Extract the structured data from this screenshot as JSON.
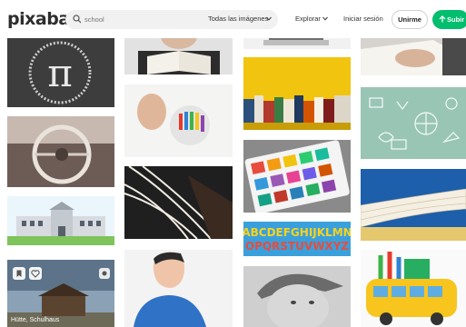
{
  "header": {
    "logo": "pixabay",
    "search_placeholder": "school",
    "filter_label": "Todas las imágenes",
    "explore_label": "Explorar",
    "login_label": "Iniciar sesión",
    "join_label": "Unirme",
    "upload_label": "Subir"
  },
  "tiles": [
    {
      "id": "chalkboard-pi",
      "description": "Chalkboard with pi symbol and digits"
    },
    {
      "id": "car-steering-wheel",
      "description": "Vintage car interior steering wheel"
    },
    {
      "id": "school-building-illustration",
      "description": "Flat illustration of school building"
    },
    {
      "id": "old-schoolhouse",
      "description": "Old wooden schoolhouse under cloudy sky"
    },
    {
      "id": "reading-book",
      "description": "Person reading a book"
    },
    {
      "id": "crayons-drawing",
      "description": "Hand drawing with crayons"
    },
    {
      "id": "open-books-pages",
      "description": "Open book pages close up"
    },
    {
      "id": "boy-silhouette",
      "description": "Illustration of boy with blue shirt"
    },
    {
      "id": "book-stack-top",
      "description": "Books stacked"
    },
    {
      "id": "books-yellow-wall",
      "description": "Books on shelf against yellow wall"
    },
    {
      "id": "watercolor-palette",
      "description": "Watercolor paint palette"
    },
    {
      "id": "alphabet-letters",
      "description": "Colorful alphabet letters"
    },
    {
      "id": "girl-cap",
      "description": "Black and white photo of girl with cap"
    },
    {
      "id": "writing-notebook",
      "description": "Hand writing in notebook"
    },
    {
      "id": "school-doodles",
      "description": "School doodles on green background"
    },
    {
      "id": "book-pages-fan",
      "description": "Fanned book pages with blue sky"
    },
    {
      "id": "school-bus-pencils",
      "description": "Yellow school bus illustration with pencils"
    }
  ],
  "overlay": {
    "caption": "Hütte, Schulhaus"
  },
  "alphabet": {
    "line1": "ABCDEFGHIJKLMN",
    "line2": "OPQRSTUVWXYZ"
  },
  "colors": {
    "accent": "#02be6e"
  }
}
